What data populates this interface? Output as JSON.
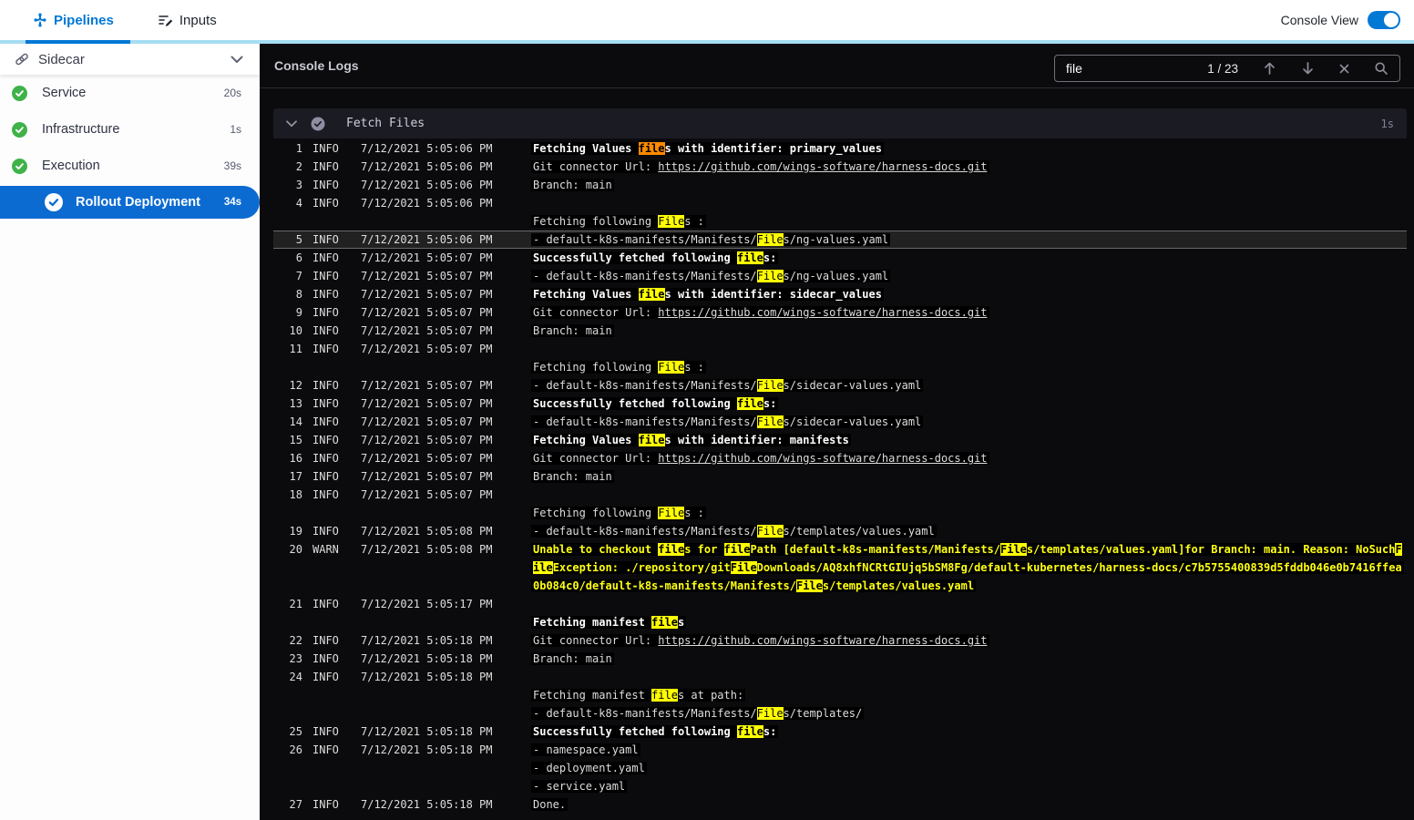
{
  "colors": {
    "accent_blue": "#0278d5",
    "selected_step_blue": "#0b6bd1",
    "success_green": "#3fb24a",
    "topbar_strip": "#a6ddf2",
    "warn_text": "#ffff14",
    "match_highlight": "#ffff00",
    "match_current": "#ff8a00",
    "console_bg": "#0b0b0d"
  },
  "topbar": {
    "tabs": [
      {
        "label": "Pipelines",
        "active": true
      },
      {
        "label": "Inputs",
        "active": false
      }
    ],
    "console_view_label": "Console View",
    "console_view_on": true
  },
  "sidebar": {
    "title": "Sidecar",
    "items": [
      {
        "label": "Service",
        "duration": "20s",
        "status": "success",
        "selected": false,
        "indent": false
      },
      {
        "label": "Infrastructure",
        "duration": "1s",
        "status": "success",
        "selected": false,
        "indent": false
      },
      {
        "label": "Execution",
        "duration": "39s",
        "status": "success",
        "selected": false,
        "indent": false
      },
      {
        "label": "Rollout Deployment",
        "duration": "34s",
        "status": "success",
        "selected": true,
        "indent": true
      }
    ]
  },
  "console": {
    "title": "Console Logs",
    "search": {
      "value": "file",
      "counter": "1 / 23"
    },
    "section": {
      "title": "Fetch Files",
      "duration": "1s",
      "status": "success"
    },
    "entries": [
      {
        "n": 1,
        "lv": "INFO",
        "t": "7/12/2021 5:05:06 PM",
        "ls": [
          {
            "b": 1,
            "s": [
              "Fetching Values ",
              [
                "file",
                "c"
              ],
              "s with identifier: primary_values"
            ]
          }
        ]
      },
      {
        "n": 2,
        "lv": "INFO",
        "t": "7/12/2021 5:05:06 PM",
        "ls": [
          {
            "s": [
              "Git connector Url: ",
              [
                "https://github.com/wings-software/harness-docs.git",
                "u"
              ]
            ]
          }
        ]
      },
      {
        "n": 3,
        "lv": "INFO",
        "t": "7/12/2021 5:05:06 PM",
        "ls": [
          {
            "s": [
              "Branch: main"
            ]
          }
        ]
      },
      {
        "n": 4,
        "lv": "INFO",
        "t": "7/12/2021 5:05:06 PM",
        "ls": [
          {
            "s": [
              ""
            ]
          },
          {
            "s": [
              "Fetching following ",
              [
                "File",
                "m"
              ],
              "s :"
            ]
          }
        ]
      },
      {
        "n": 5,
        "lv": "INFO",
        "t": "7/12/2021 5:05:06 PM",
        "hl": 1,
        "ls": [
          {
            "s": [
              "- default-k8s-manifests/Manifests/",
              [
                "File",
                "m"
              ],
              "s/ng-values.yaml"
            ]
          }
        ]
      },
      {
        "n": 6,
        "lv": "INFO",
        "t": "7/12/2021 5:05:07 PM",
        "ls": [
          {
            "b": 1,
            "s": [
              "Successfully fetched following ",
              [
                "file",
                "m"
              ],
              "s:"
            ]
          }
        ]
      },
      {
        "n": 7,
        "lv": "INFO",
        "t": "7/12/2021 5:05:07 PM",
        "ls": [
          {
            "s": [
              "- default-k8s-manifests/Manifests/",
              [
                "File",
                "m"
              ],
              "s/ng-values.yaml"
            ]
          }
        ]
      },
      {
        "n": 8,
        "lv": "INFO",
        "t": "7/12/2021 5:05:07 PM",
        "ls": [
          {
            "b": 1,
            "s": [
              "Fetching Values ",
              [
                "file",
                "m"
              ],
              "s with identifier: sidecar_values"
            ]
          }
        ]
      },
      {
        "n": 9,
        "lv": "INFO",
        "t": "7/12/2021 5:05:07 PM",
        "ls": [
          {
            "s": [
              "Git connector Url: ",
              [
                "https://github.com/wings-software/harness-docs.git",
                "u"
              ]
            ]
          }
        ]
      },
      {
        "n": 10,
        "lv": "INFO",
        "t": "7/12/2021 5:05:07 PM",
        "ls": [
          {
            "s": [
              "Branch: main"
            ]
          }
        ]
      },
      {
        "n": 11,
        "lv": "INFO",
        "t": "7/12/2021 5:05:07 PM",
        "ls": [
          {
            "s": [
              ""
            ]
          },
          {
            "s": [
              "Fetching following ",
              [
                "File",
                "m"
              ],
              "s :"
            ]
          }
        ]
      },
      {
        "n": 12,
        "lv": "INFO",
        "t": "7/12/2021 5:05:07 PM",
        "ls": [
          {
            "s": [
              "- default-k8s-manifests/Manifests/",
              [
                "File",
                "m"
              ],
              "s/sidecar-values.yaml"
            ]
          }
        ]
      },
      {
        "n": 13,
        "lv": "INFO",
        "t": "7/12/2021 5:05:07 PM",
        "ls": [
          {
            "b": 1,
            "s": [
              "Successfully fetched following ",
              [
                "file",
                "m"
              ],
              "s:"
            ]
          }
        ]
      },
      {
        "n": 14,
        "lv": "INFO",
        "t": "7/12/2021 5:05:07 PM",
        "ls": [
          {
            "s": [
              "- default-k8s-manifests/Manifests/",
              [
                "File",
                "m"
              ],
              "s/sidecar-values.yaml"
            ]
          }
        ]
      },
      {
        "n": 15,
        "lv": "INFO",
        "t": "7/12/2021 5:05:07 PM",
        "ls": [
          {
            "b": 1,
            "s": [
              "Fetching Values ",
              [
                "file",
                "m"
              ],
              "s with identifier: manifests"
            ]
          }
        ]
      },
      {
        "n": 16,
        "lv": "INFO",
        "t": "7/12/2021 5:05:07 PM",
        "ls": [
          {
            "s": [
              "Git connector Url: ",
              [
                "https://github.com/wings-software/harness-docs.git",
                "u"
              ]
            ]
          }
        ]
      },
      {
        "n": 17,
        "lv": "INFO",
        "t": "7/12/2021 5:05:07 PM",
        "ls": [
          {
            "s": [
              "Branch: main"
            ]
          }
        ]
      },
      {
        "n": 18,
        "lv": "INFO",
        "t": "7/12/2021 5:05:07 PM",
        "ls": [
          {
            "s": [
              ""
            ]
          },
          {
            "s": [
              "Fetching following ",
              [
                "File",
                "m"
              ],
              "s :"
            ]
          }
        ]
      },
      {
        "n": 19,
        "lv": "INFO",
        "t": "7/12/2021 5:05:08 PM",
        "ls": [
          {
            "s": [
              "- default-k8s-manifests/Manifests/",
              [
                "File",
                "m"
              ],
              "s/templates/values.yaml"
            ]
          }
        ]
      },
      {
        "n": 20,
        "lv": "WARN",
        "t": "7/12/2021 5:05:08 PM",
        "w": 1,
        "ls": [
          {
            "s": [
              "Unable to checkout ",
              [
                "file",
                "m"
              ],
              "s for ",
              [
                "file",
                "m"
              ],
              "Path [default-k8s-manifests/Manifests/",
              [
                "File",
                "m"
              ],
              "s/templates/values.yaml]for Branch: main. Reason: NoSuch",
              [
                "F",
                "m"
              ]
            ]
          },
          {
            "s": [
              [
                "ile",
                "m"
              ],
              "Exception: ./repository/git",
              [
                "File",
                "m"
              ],
              "Downloads/AQ8xhfNCRtGIUjq5bSM8Fg/default-kubernetes/harness-docs/c7b5755400839d5fddb046e0b7416ffea"
            ]
          },
          {
            "s": [
              "0b084c0/default-k8s-manifests/Manifests/",
              [
                "File",
                "m"
              ],
              "s/templates/values.yaml"
            ]
          }
        ]
      },
      {
        "n": 21,
        "lv": "INFO",
        "t": "7/12/2021 5:05:17 PM",
        "ls": [
          {
            "s": [
              ""
            ]
          },
          {
            "b": 1,
            "s": [
              "Fetching manifest ",
              [
                "file",
                "m"
              ],
              "s"
            ]
          }
        ]
      },
      {
        "n": 22,
        "lv": "INFO",
        "t": "7/12/2021 5:05:18 PM",
        "ls": [
          {
            "s": [
              "Git connector Url: ",
              [
                "https://github.com/wings-software/harness-docs.git",
                "u"
              ]
            ]
          }
        ]
      },
      {
        "n": 23,
        "lv": "INFO",
        "t": "7/12/2021 5:05:18 PM",
        "ls": [
          {
            "s": [
              "Branch: main"
            ]
          }
        ]
      },
      {
        "n": 24,
        "lv": "INFO",
        "t": "7/12/2021 5:05:18 PM",
        "ls": [
          {
            "s": [
              ""
            ]
          },
          {
            "s": [
              "Fetching manifest ",
              [
                "file",
                "m"
              ],
              "s at path:"
            ]
          },
          {
            "s": [
              "- default-k8s-manifests/Manifests/",
              [
                "File",
                "m"
              ],
              "s/templates/"
            ]
          }
        ]
      },
      {
        "n": 25,
        "lv": "INFO",
        "t": "7/12/2021 5:05:18 PM",
        "ls": [
          {
            "b": 1,
            "s": [
              "Successfully fetched following ",
              [
                "file",
                "m"
              ],
              "s:"
            ]
          }
        ]
      },
      {
        "n": 26,
        "lv": "INFO",
        "t": "7/12/2021 5:05:18 PM",
        "ls": [
          {
            "s": [
              "- namespace.yaml"
            ]
          },
          {
            "s": [
              "- deployment.yaml"
            ]
          },
          {
            "s": [
              "- service.yaml"
            ]
          }
        ]
      },
      {
        "n": 27,
        "lv": "INFO",
        "t": "7/12/2021 5:05:18 PM",
        "ls": [
          {
            "s": [
              "Done."
            ]
          }
        ]
      }
    ]
  }
}
